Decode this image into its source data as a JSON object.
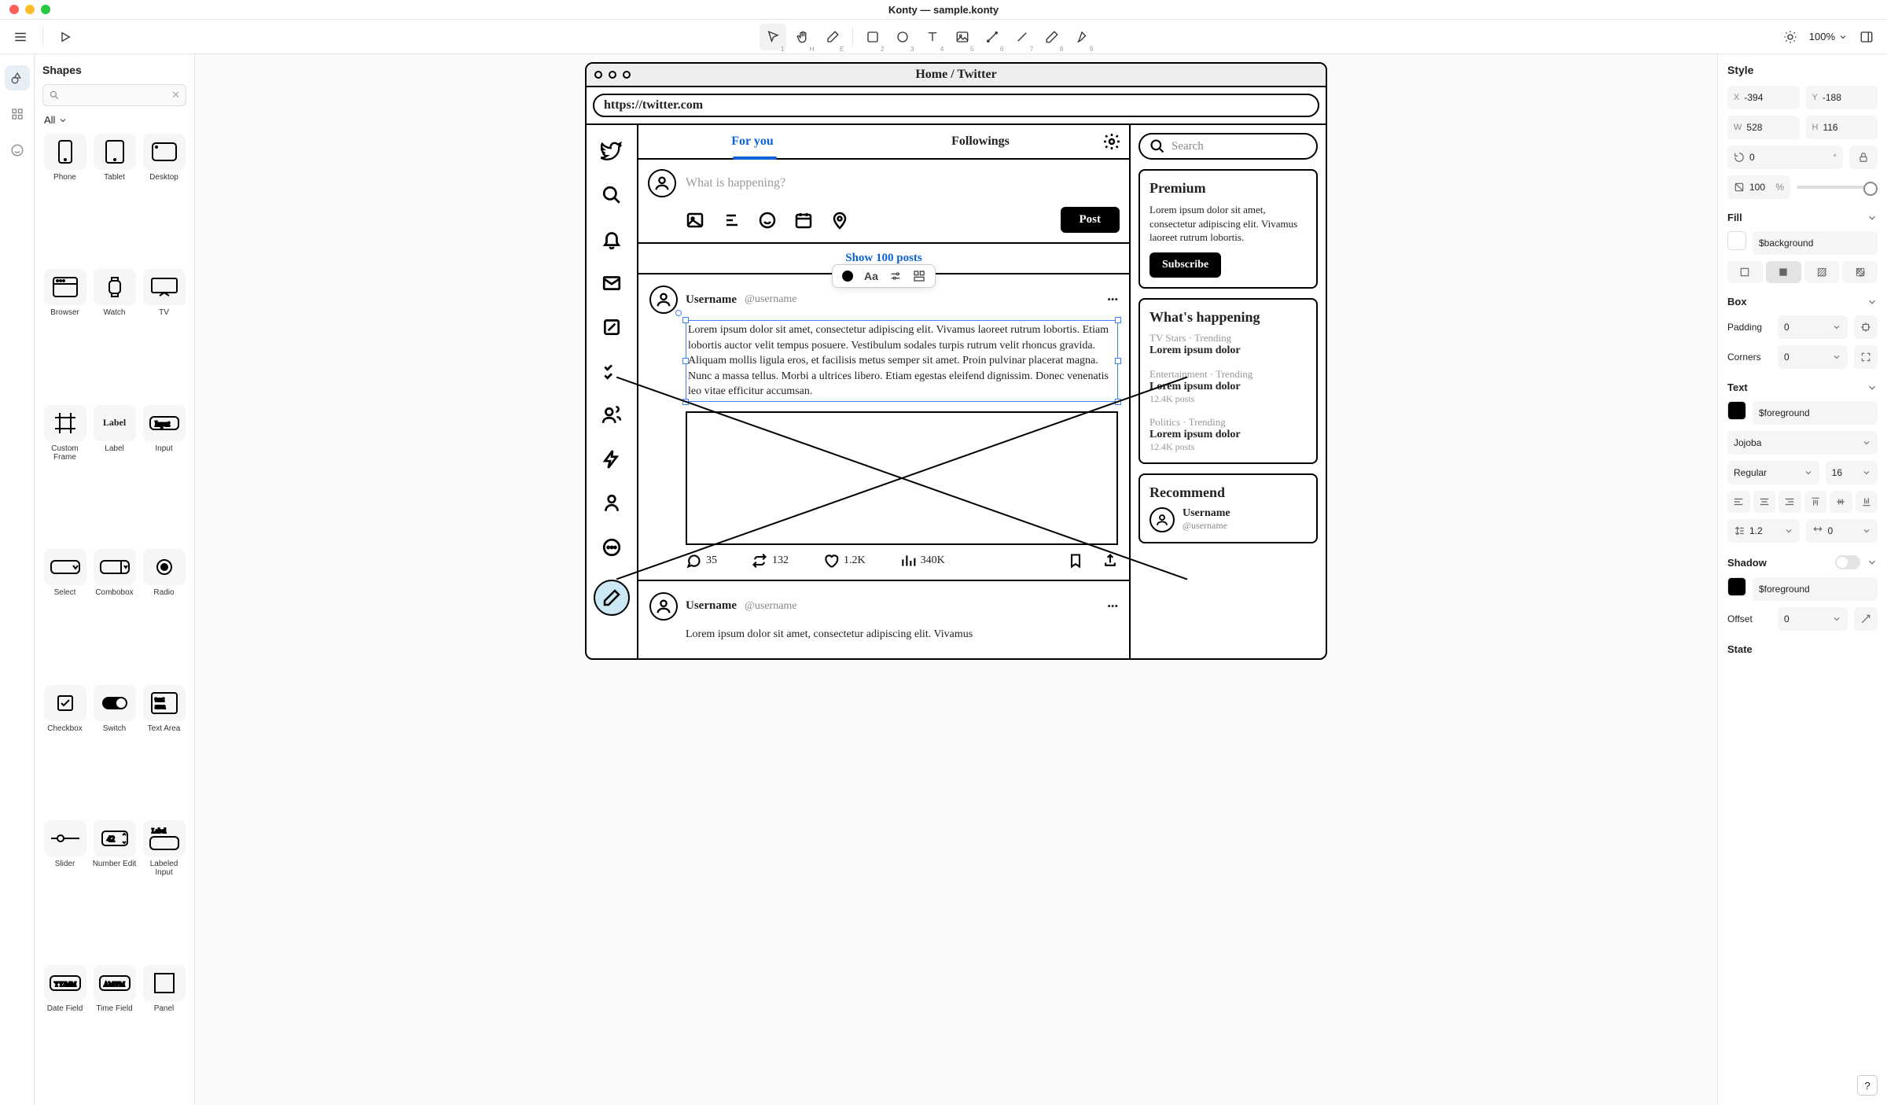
{
  "window": {
    "title": "Konty — sample.konty"
  },
  "toolbar": {
    "tools": [
      {
        "name": "select",
        "key": "1"
      },
      {
        "name": "hand",
        "key": "H"
      },
      {
        "name": "eraser",
        "key": "E"
      },
      {
        "name": "rect",
        "key": "2"
      },
      {
        "name": "ellipse",
        "key": "3"
      },
      {
        "name": "text",
        "key": "4"
      },
      {
        "name": "image",
        "key": "5"
      },
      {
        "name": "line",
        "key": "6"
      },
      {
        "name": "line2",
        "key": "7"
      },
      {
        "name": "pencil",
        "key": "8"
      },
      {
        "name": "highlighter",
        "key": "9"
      }
    ],
    "zoom": "100%"
  },
  "shapesPanel": {
    "title": "Shapes",
    "filter": "All",
    "items": [
      "Phone",
      "Tablet",
      "Desktop",
      "Browser",
      "Watch",
      "TV",
      "Custom Frame",
      "Label",
      "Input",
      "Select",
      "Combobox",
      "Radio",
      "Checkbox",
      "Switch",
      "Text Area",
      "Slider",
      "Number Edit",
      "Labeled Input",
      "Date Field",
      "Time Field",
      "Panel"
    ]
  },
  "canvas": {
    "browserTitle": "Home / Twitter",
    "url": "https://twitter.com",
    "tabs": {
      "active": "For you",
      "other": "Followings"
    },
    "composePlaceholder": "What is happening?",
    "postButton": "Post",
    "showPosts": "Show 100 posts",
    "tweet": {
      "name": "Username",
      "handle": "@username",
      "body": "Lorem ipsum dolor sit amet, consectetur adipiscing elit. Vivamus laoreet rutrum lobortis. Etiam lobortis auctor velit tempus posuere. Vestibulum sodales turpis rutrum velit rhoncus gravida. Aliquam mollis ligula eros, et facilisis metus semper sit amet. Proin pulvinar placerat magna. Nunc a massa tellus. Morbi a ultrices libero. Etiam egestas eleifend dignissim. Donec venenatis leo vitae efficitur accumsan.",
      "replies": "35",
      "retweets": "132",
      "likes": "1.2K",
      "views": "340K"
    },
    "tweet2": {
      "name": "Username",
      "handle": "@username",
      "body": "Lorem ipsum dolor sit amet, consectetur adipiscing elit. Vivamus"
    },
    "search": "Search",
    "premium": {
      "title": "Premium",
      "body": "Lorem ipsum dolor sit amet, consectetur adipiscing elit. Vivamus laoreet rutrum lobortis.",
      "cta": "Subscribe"
    },
    "happening": {
      "title": "What's happening",
      "trends": [
        {
          "cat": "TV Stars · Trending",
          "title": "Lorem ipsum dolor"
        },
        {
          "cat": "Entertainment · Trending",
          "title": "Lorem ipsum dolor",
          "count": "12.4K posts"
        },
        {
          "cat": "Politics · Trending",
          "title": "Lorem ipsum dolor",
          "count": "12.4K posts"
        }
      ]
    },
    "recommend": {
      "title": "Recommend",
      "name": "Username",
      "handle": "@username"
    }
  },
  "style": {
    "title": "Style",
    "x": "-394",
    "y": "-188",
    "w": "528",
    "h": "116",
    "rotation": "0",
    "opacity": "100",
    "fill": {
      "title": "Fill",
      "value": "$background"
    },
    "box": {
      "title": "Box",
      "padding": "Padding",
      "paddingVal": "0",
      "corners": "Corners",
      "cornersVal": "0"
    },
    "text": {
      "title": "Text",
      "color": "$foreground",
      "font": "Jojoba",
      "weight": "Regular",
      "size": "16",
      "lineHeight": "1.2",
      "letterSpacing": "0"
    },
    "shadow": {
      "title": "Shadow",
      "color": "$foreground",
      "offsetLabel": "Offset",
      "offset": "0"
    },
    "state": {
      "title": "State"
    }
  },
  "help": "?"
}
